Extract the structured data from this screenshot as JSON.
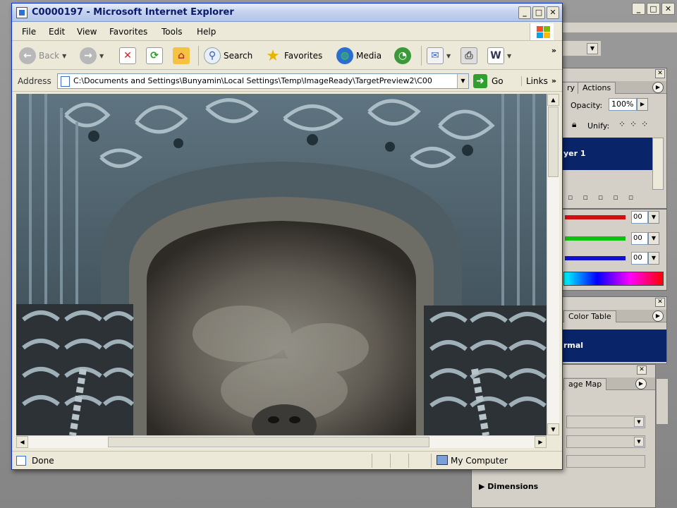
{
  "browser": {
    "title": "C0000197 - Microsoft Internet Explorer",
    "menu": [
      "File",
      "Edit",
      "View",
      "Favorites",
      "Tools",
      "Help"
    ],
    "toolbar": {
      "back": "Back",
      "search": "Search",
      "favorites": "Favorites",
      "media": "Media"
    },
    "address_label": "Address",
    "address_value": "C:\\Documents and Settings\\Bunyamin\\Local Settings\\Temp\\ImageReady\\TargetPreview2\\C00",
    "go_label": "Go",
    "links_label": "Links",
    "overflow": "»",
    "status_text": "Done",
    "zone_text": "My Computer"
  },
  "imageready": {
    "layers_panel": {
      "tabs": [
        "ry",
        "Actions"
      ],
      "opacity_label": "Opacity:",
      "opacity_value": "100%",
      "unify_label": "Unify:",
      "layer_name": "yer 1"
    },
    "color_panel": {
      "values": [
        "00",
        "00",
        "00"
      ],
      "slider_colors": [
        "#d01010",
        "#10c010",
        "#1010d0"
      ]
    },
    "colortable_panel": {
      "tab": "Color Table",
      "blend_mode": "rmal"
    },
    "imagemap_panel": {
      "tab": "age Map",
      "dimensions_label": "Dimensions"
    }
  },
  "colors": {
    "titlebar": "#c6d3ef",
    "selection": "#0a246a",
    "chrome": "#ece9d8"
  }
}
